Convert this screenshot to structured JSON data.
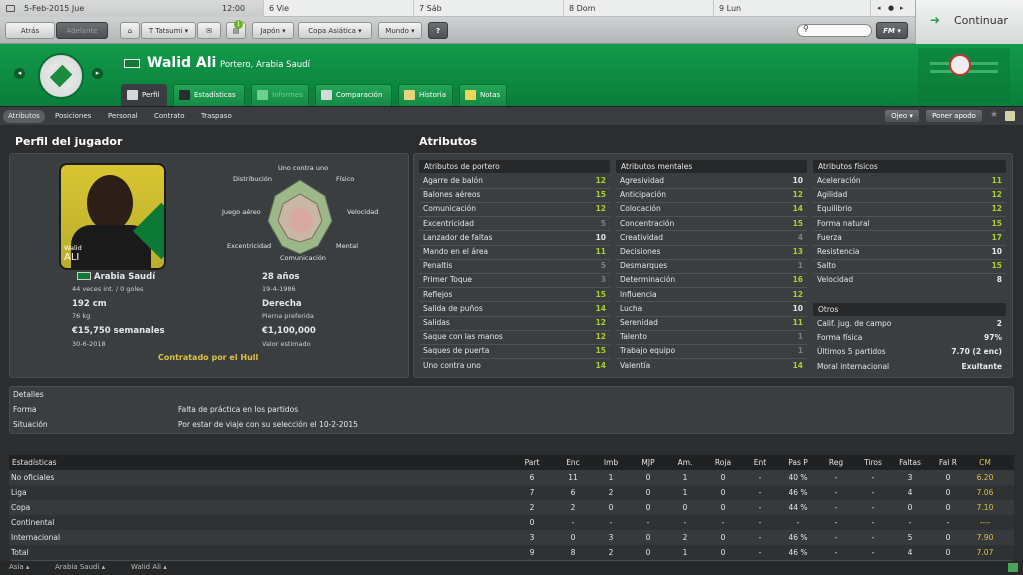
{
  "calendar": {
    "days": [
      "5-Feb-2015 Jue",
      "6 Vie",
      "7 Sáb",
      "8 Dom",
      "9 Lun"
    ],
    "time": "12:00",
    "continue_label": "Continuar"
  },
  "nav": {
    "back": "Atrás",
    "forward": "Adelante",
    "manager": "T Tatsumi",
    "notif_count": "1",
    "menus": [
      "Japón",
      "Copa Asiática",
      "Mundo"
    ],
    "help": "?",
    "search_placeholder": "",
    "fm_label": "FM"
  },
  "player": {
    "name": "Walid Ali",
    "subtitle": "Portero, Arabia Saudí",
    "card_first": "Walid",
    "card_last": "ALI",
    "nation": "Arabia Saudí",
    "caps": "44 veces int. / 0 goles",
    "age": "28 años",
    "dob": "19-4-1986",
    "height": "192 cm",
    "weight": "76 kg",
    "foot": "Derecha",
    "foot_label": "Pierna preferida",
    "wage": "€15,750 semanales",
    "contract_end": "30-6-2018",
    "value": "€1,100,000",
    "value_label": "Valor estimado",
    "status": "Contratado por el Hull"
  },
  "header_tabs": [
    "Perfil",
    "Estadísticas",
    "Informes",
    "Comparación",
    "Historia",
    "Notas"
  ],
  "sub_tabs": [
    "Atributos",
    "Posiciones",
    "Personal",
    "Contrato",
    "Traspaso"
  ],
  "actions": {
    "scout": "Ojeo",
    "nickname": "Poner apodo"
  },
  "profile_title": "Perfil del jugador",
  "radar_labels": [
    "Uno contra uno",
    "Físico",
    "Velocidad",
    "Mental",
    "Comunicación",
    "Excentricidad",
    "Juego aéreo",
    "Distribución"
  ],
  "attributes_title": "Atributos",
  "gk_title": "Atributos de portero",
  "gk": [
    [
      "Agarre de balón",
      "12",
      "g"
    ],
    [
      "Balones aéreos",
      "15",
      "g"
    ],
    [
      "Comunicación",
      "12",
      "g"
    ],
    [
      "Excentricidad",
      "5",
      "d"
    ],
    [
      "Lanzador de faltas",
      "10",
      "w"
    ],
    [
      "Mando en el área",
      "11",
      "g"
    ],
    [
      "Penaltis",
      "5",
      "d"
    ],
    [
      "Primer Toque",
      "3",
      "d"
    ],
    [
      "Reflejos",
      "15",
      "g"
    ],
    [
      "Salida de puños",
      "14",
      "g"
    ],
    [
      "Salidas",
      "12",
      "g"
    ],
    [
      "Saque con las manos",
      "12",
      "g"
    ],
    [
      "Saques de puerta",
      "15",
      "g"
    ],
    [
      "Uno contra uno",
      "14",
      "g"
    ]
  ],
  "mental_title": "Atributos mentales",
  "mental": [
    [
      "Agresividad",
      "10",
      "w"
    ],
    [
      "Anticipación",
      "12",
      "g"
    ],
    [
      "Colocación",
      "14",
      "g"
    ],
    [
      "Concentración",
      "15",
      "g"
    ],
    [
      "Creatividad",
      "4",
      "d"
    ],
    [
      "Decisiones",
      "13",
      "g"
    ],
    [
      "Desmarques",
      "1",
      "d"
    ],
    [
      "Determinación",
      "16",
      "g"
    ],
    [
      "Influencia",
      "12",
      "g"
    ],
    [
      "Lucha",
      "10",
      "w"
    ],
    [
      "Serenidad",
      "11",
      "g"
    ],
    [
      "Talento",
      "1",
      "d"
    ],
    [
      "Trabajo equipo",
      "1",
      "d"
    ],
    [
      "Valentía",
      "14",
      "g"
    ]
  ],
  "physical_title": "Atributos físicos",
  "physical": [
    [
      "Aceleración",
      "11",
      "g"
    ],
    [
      "Agilidad",
      "12",
      "g"
    ],
    [
      "Equilibrio",
      "12",
      "g"
    ],
    [
      "Forma natural",
      "15",
      "g"
    ],
    [
      "Fuerza",
      "17",
      "g"
    ],
    [
      "Resistencia",
      "10",
      "w"
    ],
    [
      "Salto",
      "15",
      "g"
    ],
    [
      "Velocidad",
      "8",
      "w"
    ]
  ],
  "others_title": "Otros",
  "others": [
    [
      "Calif. jug. de campo",
      "2"
    ],
    [
      "Forma física",
      "97%"
    ],
    [
      "Últimos 5 partidos",
      "7.70 (2 enc)"
    ],
    [
      "Moral internacional",
      "Exultante"
    ]
  ],
  "details": {
    "title": "Detalles",
    "rows": [
      [
        "Forma",
        "Falta de práctica en los partidos"
      ],
      [
        "Situación",
        "Por estar de viaje con su selección el 10-2-2015"
      ]
    ]
  },
  "stats": {
    "title": "Estadísticas",
    "headers": [
      "Part",
      "Enc",
      "Imb",
      "MJP",
      "Am.",
      "Roja",
      "Ent",
      "Pas P",
      "Reg",
      "Tiros",
      "Faltas",
      "Fal R",
      "CM"
    ],
    "rows": [
      [
        "No oficiales",
        "6",
        "11",
        "1",
        "0",
        "1",
        "0",
        "-",
        "40 %",
        "-",
        "-",
        "3",
        "0",
        "6.20"
      ],
      [
        "Liga",
        "7",
        "6",
        "2",
        "0",
        "1",
        "0",
        "-",
        "46 %",
        "-",
        "-",
        "4",
        "0",
        "7.06"
      ],
      [
        "Copa",
        "2",
        "2",
        "0",
        "0",
        "0",
        "0",
        "-",
        "44 %",
        "-",
        "-",
        "0",
        "0",
        "7.10"
      ],
      [
        "Continental",
        "0",
        "-",
        "-",
        "-",
        "-",
        "-",
        "-",
        "-",
        "-",
        "-",
        "-",
        "-",
        "----"
      ],
      [
        "Internacional",
        "3",
        "0",
        "3",
        "0",
        "2",
        "0",
        "-",
        "46 %",
        "-",
        "-",
        "5",
        "0",
        "7.90"
      ],
      [
        "Total",
        "9",
        "8",
        "2",
        "0",
        "1",
        "0",
        "-",
        "46 %",
        "-",
        "-",
        "4",
        "0",
        "7.07"
      ]
    ]
  },
  "breadcrumb": [
    "Asia",
    "Arabia Saudí",
    "Walid Ali"
  ],
  "colors": {
    "green": "#0f8f44",
    "good": "#a7d12c",
    "avg": "#e8e8e8",
    "cm": "#e0c040"
  }
}
